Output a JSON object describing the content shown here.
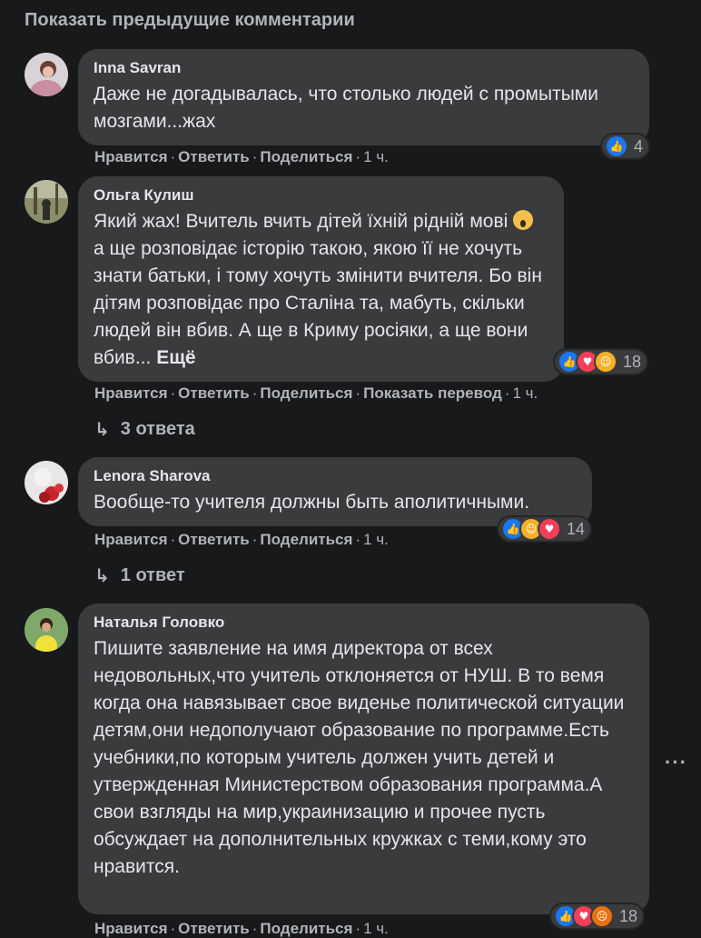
{
  "show_previous": "Показать предыдущие комментарии",
  "comments": [
    {
      "author": "Inna Savran",
      "text": "Даже не догадывалась, что столько людей с промытыми мозгами...жах",
      "actions": {
        "like": "Нравится",
        "reply": "Ответить",
        "share": "Поделиться",
        "time": "1 ч."
      },
      "reactions": {
        "icons": [
          "like-icon"
        ],
        "count": "4"
      }
    },
    {
      "author": "Ольга Кулиш",
      "text_before_emoji": "Який жах! Вчитель вчить дітей їхній рідній мові ",
      "text_after_emoji": " а ще розповідає історію такою, якою її не хочуть знати батьки, і тому хочуть змінити вчителя. Бо він дітям розповідає про Сталіна та, мабуть, скільки людей він вбив. А ще в Криму росіяки, а ще вони вбив...",
      "more": "Ещё",
      "actions": {
        "like": "Нравится",
        "reply": "Ответить",
        "share": "Поделиться",
        "translate": "Показать перевод",
        "time": "1 ч."
      },
      "reactions": {
        "icons": [
          "like-icon",
          "love-icon",
          "care-icon"
        ],
        "count": "18"
      },
      "replies": "3 ответа"
    },
    {
      "author": "Lenora Sharova",
      "text": "Вообще-то учителя должны быть аполитичными.",
      "actions": {
        "like": "Нравится",
        "reply": "Ответить",
        "share": "Поделиться",
        "time": "1 ч."
      },
      "reactions": {
        "icons": [
          "like-icon",
          "haha-icon",
          "love-icon"
        ],
        "count": "14"
      },
      "replies": "1 ответ"
    },
    {
      "author": "Наталья Головко",
      "text": "Пишите заявление на имя директора от всех недовольных,что учитель отклоняется от НУШ. В то вемя когда она навязывает свое виденье политической ситуации детям,они недополучают образование по программе.Есть учебники,по которым учитель должен учить детей и утвержденная Министерством образования программа.А свои взгляды на мир,украинизацию и прочее пусть обсуждает на дополнительных кружках с теми,кому это нравится.",
      "actions": {
        "like": "Нравится",
        "reply": "Ответить",
        "share": "Поделиться",
        "time": "1 ч."
      },
      "reactions": {
        "icons": [
          "like-icon",
          "love-icon",
          "angry-icon"
        ],
        "count": "18"
      }
    }
  ],
  "colors": {
    "background": "#18191a",
    "bubble": "#3a3b3c",
    "text": "#e4e6eb",
    "secondary": "#b0b3b8",
    "like": "#1877f2",
    "love": "#f33e58",
    "haha": "#f7b125",
    "angry": "#e9710f"
  }
}
